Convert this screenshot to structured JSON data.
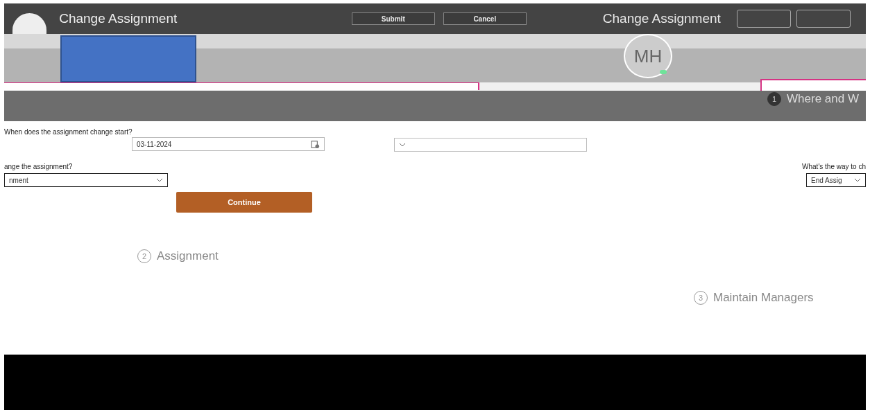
{
  "header": {
    "title": "Change Assignment",
    "buttons": [
      "Submit",
      "Cancel"
    ],
    "title_2": "Change Assignment",
    "avatar": "MH"
  },
  "fields": [
    {
      "kind": "date",
      "label": "When does the assignment change start?",
      "value": "03-11-2024"
    },
    {
      "kind": "select"
    },
    {
      "kind": "select",
      "label": "ange the assignment?",
      "value": "nment"
    },
    {
      "kind": "select",
      "label": "What's the way to ch",
      "value": "End Assig"
    }
  ],
  "continue": "Continue",
  "steps": [
    {
      "number": "1",
      "label": "Where and W"
    },
    {
      "number": "2",
      "label": "Assignment"
    },
    {
      "number": "3",
      "label": "Maintain Managers"
    }
  ]
}
